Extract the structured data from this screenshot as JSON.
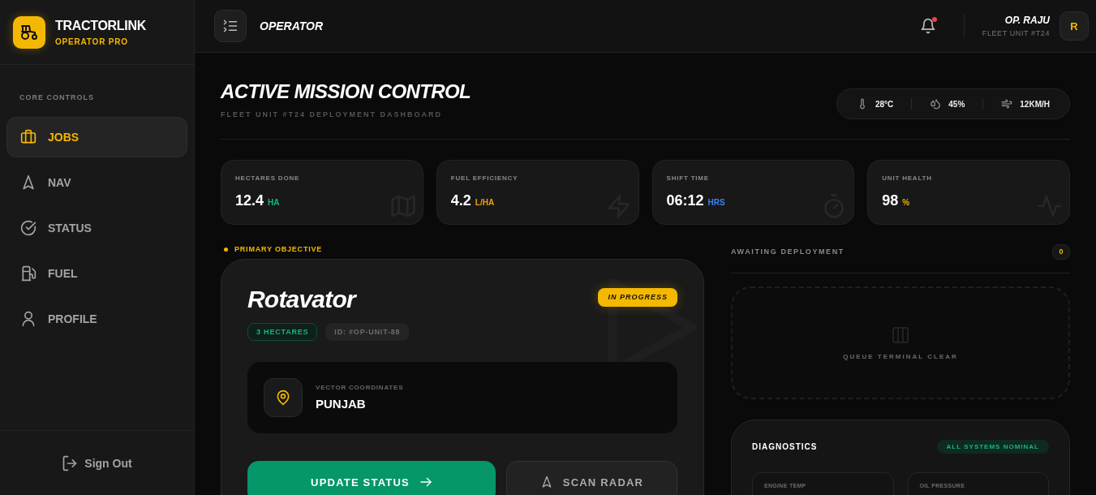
{
  "sidebar": {
    "brand": {
      "name": "TRACTORLINK",
      "tagline": "OPERATOR PRO"
    },
    "section_label": "CORE CONTROLS",
    "items": [
      {
        "label": "JOBS",
        "selected": true
      },
      {
        "label": "NAV",
        "selected": false
      },
      {
        "label": "STATUS",
        "selected": false
      },
      {
        "label": "FUEL",
        "selected": false
      },
      {
        "label": "PROFILE",
        "selected": false
      }
    ],
    "sign_out": "Sign Out"
  },
  "header": {
    "title": "OPERATOR",
    "notifications": {
      "unread": true
    },
    "user": {
      "name": "OP. RAJU",
      "unit": "FLEET UNIT #T24",
      "initial": "R"
    }
  },
  "page": {
    "title": "ACTIVE MISSION CONTROL",
    "subtitle": "FLEET UNIT #T24 DEPLOYMENT DASHBOARD",
    "weather": [
      {
        "value": "28°C"
      },
      {
        "value": "45%"
      },
      {
        "value": "12KM/H"
      }
    ]
  },
  "stats": [
    {
      "label": "HECTARES DONE",
      "value": "12.4",
      "unit": "HA",
      "color": "#10b981"
    },
    {
      "label": "FUEL EFFICIENCY",
      "value": "4.2",
      "unit": "L/HA",
      "color": "#f59e0b"
    },
    {
      "label": "SHIFT TIME",
      "value": "06:12",
      "unit": "HRS",
      "color": "#3b82f6"
    },
    {
      "label": "UNIT HEALTH",
      "value": "98",
      "unit": "%",
      "color": "#eab308"
    }
  ],
  "mission": {
    "section_label": "PRIMARY OBJECTIVE",
    "name": "Rotavator",
    "status": "IN PROGRESS",
    "tags": [
      {
        "kind": "area",
        "text": "3 HECTARES"
      },
      {
        "kind": "id",
        "text": "ID: #OP-UNIT-88"
      }
    ],
    "location": {
      "label": "VECTOR COORDINATES",
      "value": "PUNJAB"
    },
    "actions": [
      {
        "kind": "primary",
        "label": "UPDATE STATUS"
      },
      {
        "kind": "secondary",
        "label": "SCAN RADAR"
      }
    ]
  },
  "queue": {
    "title": "AWAITING DEPLOYMENT",
    "count": "0",
    "empty_message": "QUEUE TERMINAL CLEAR"
  },
  "diagnostics": {
    "title": "DIAGNOSTICS",
    "status": "ALL SYSTEMS NOMINAL",
    "metrics": [
      {
        "label": "ENGINE TEMP"
      },
      {
        "label": "OIL PRESSURE"
      }
    ]
  }
}
